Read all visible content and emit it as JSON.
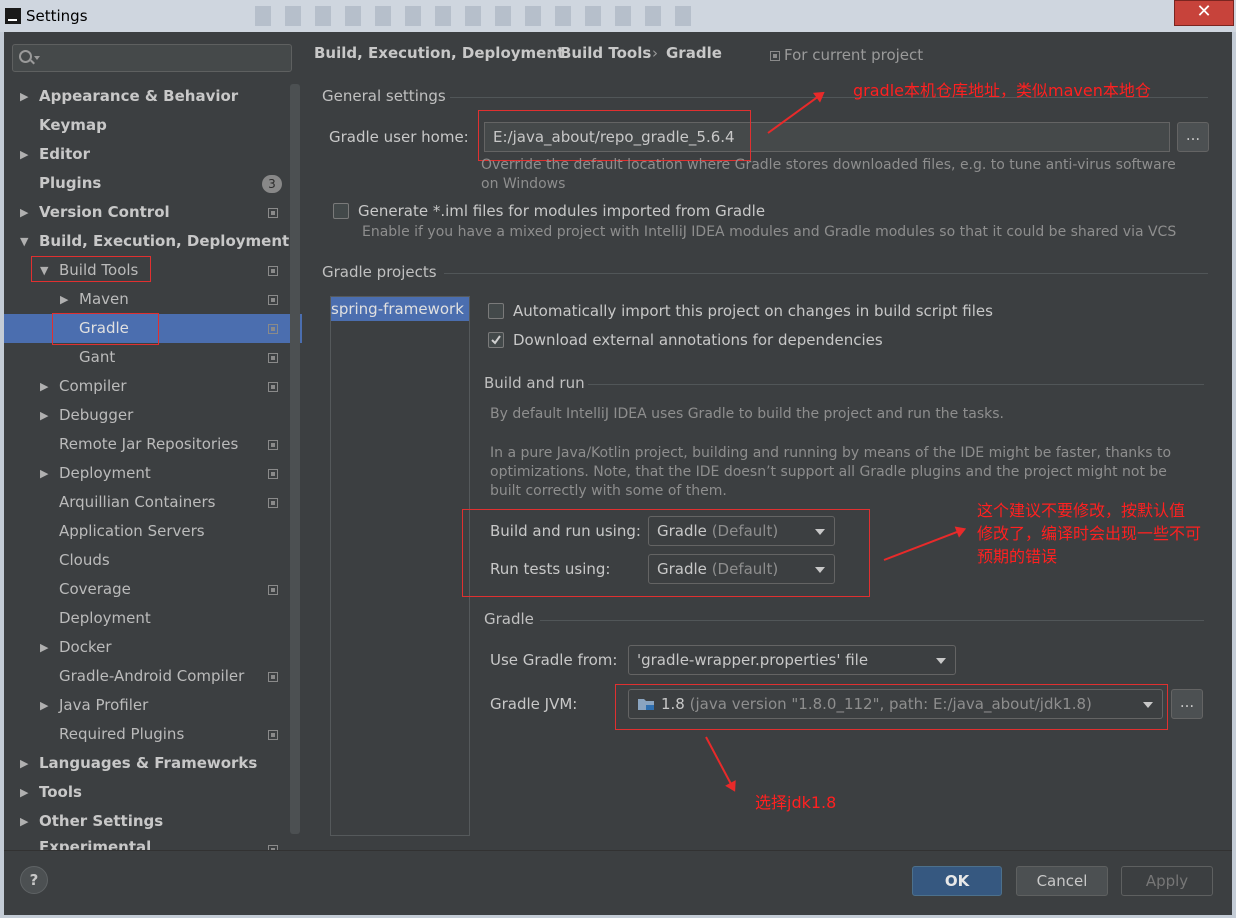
{
  "window": {
    "title": "Settings",
    "close_glyph": "✕"
  },
  "search": {
    "placeholder": ""
  },
  "sidebar": {
    "items": [
      {
        "label": "Appearance & Behavior"
      },
      {
        "label": "Keymap"
      },
      {
        "label": "Editor"
      },
      {
        "label": "Plugins",
        "badge": "3"
      },
      {
        "label": "Version Control"
      },
      {
        "label": "Build, Execution, Deployment"
      },
      {
        "label": "Build Tools"
      },
      {
        "label": "Maven"
      },
      {
        "label": "Gradle",
        "selected": true
      },
      {
        "label": "Gant"
      },
      {
        "label": "Compiler"
      },
      {
        "label": "Debugger"
      },
      {
        "label": "Remote Jar Repositories"
      },
      {
        "label": "Deployment"
      },
      {
        "label": "Arquillian Containers"
      },
      {
        "label": "Application Servers"
      },
      {
        "label": "Clouds"
      },
      {
        "label": "Coverage"
      },
      {
        "label": "Deployment"
      },
      {
        "label": "Docker"
      },
      {
        "label": "Gradle-Android Compiler"
      },
      {
        "label": "Java Profiler"
      },
      {
        "label": "Required Plugins"
      },
      {
        "label": "Languages & Frameworks"
      },
      {
        "label": "Tools"
      },
      {
        "label": "Other Settings"
      },
      {
        "label": "Experimental"
      }
    ]
  },
  "breadcrumb": {
    "items": [
      "Build, Execution, Deployment",
      "Build Tools",
      "Gradle"
    ],
    "separator": "›",
    "scope": "For current project"
  },
  "general": {
    "title": "General settings",
    "user_home_label": "Gradle user home:",
    "user_home_value": "E:/java_about/repo_gradle_5.6.4",
    "browse": "...",
    "user_home_hint": "Override the default location where Gradle stores downloaded files, e.g. to tune anti-virus software on Windows",
    "iml_label": "Generate *.iml files for modules imported from Gradle",
    "iml_hint": "Enable if you have a mixed project with IntelliJ IDEA modules and Gradle modules so that it could be shared via VCS",
    "iml_checked": false
  },
  "projects": {
    "title": "Gradle projects",
    "list": [
      "spring-framework"
    ],
    "auto_import_label": "Automatically import this project on changes in build script files",
    "auto_import_checked": false,
    "annotations_label": "Download external annotations for dependencies",
    "annotations_checked": true
  },
  "build_run": {
    "title": "Build and run",
    "desc1": "By default IntelliJ IDEA uses Gradle to build the project and run the tasks.",
    "desc2": "In a pure Java/Kotlin project, building and running by means of the IDE might be faster, thanks to optimizations. Note, that the IDE doesn’t support all Gradle plugins and the project might not be built correctly with some of them.",
    "using_label": "Build and run using:",
    "using_value": "Gradle",
    "using_suffix": "(Default)",
    "tests_label": "Run tests using:",
    "tests_value": "Gradle",
    "tests_suffix": "(Default)"
  },
  "gradle": {
    "title": "Gradle",
    "use_from_label": "Use Gradle from:",
    "use_from_value": "'gradle-wrapper.properties' file",
    "jvm_label": "Gradle JVM:",
    "jvm_value": "1.8",
    "jvm_detail": "(java version \"1.8.0_112\", path: E:/java_about/jdk1.8)",
    "browse": "..."
  },
  "annotations": {
    "home_note": "gradle本机仓库地址，类似maven本地仓",
    "build_note_1": "这个建议不要修改，按默认值",
    "build_note_2": "修改了，编译时会出现一些不可",
    "build_note_3": "预期的错误",
    "jvm_note": "选择jdk1.8"
  },
  "footer": {
    "help": "?",
    "ok": "OK",
    "cancel": "Cancel",
    "apply": "Apply"
  },
  "colors": {
    "selection": "#4b6eaf",
    "annotation": "#ff2020",
    "ok_button": "#365880"
  }
}
